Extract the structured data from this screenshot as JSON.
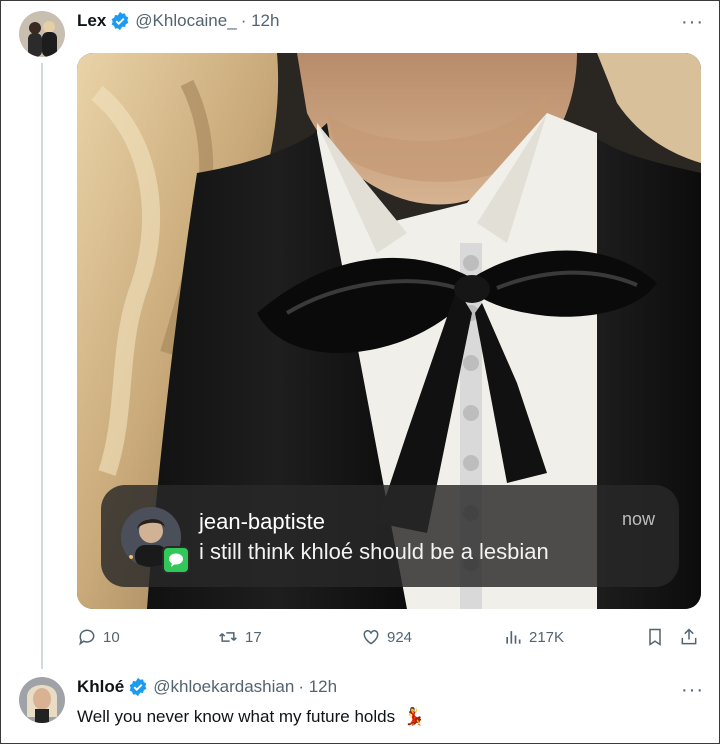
{
  "tweet": {
    "name": "Lex",
    "handle": "@Khlocaine_",
    "time": "· 12h",
    "notification": {
      "sender": "jean-baptiste",
      "message": "i still think khloé should be a lesbian",
      "time": "now"
    },
    "stats": {
      "replies": "10",
      "retweets": "17",
      "likes": "924",
      "views": "217K"
    }
  },
  "reply": {
    "name": "Khloé",
    "handle": "@khloekardashian",
    "time": "· 12h",
    "text": "Well you never know what my future holds",
    "emoji": "💃"
  },
  "colors": {
    "verified": "#1d9bf0",
    "secondary_text": "#536471",
    "imessage_green": "#31c759"
  }
}
